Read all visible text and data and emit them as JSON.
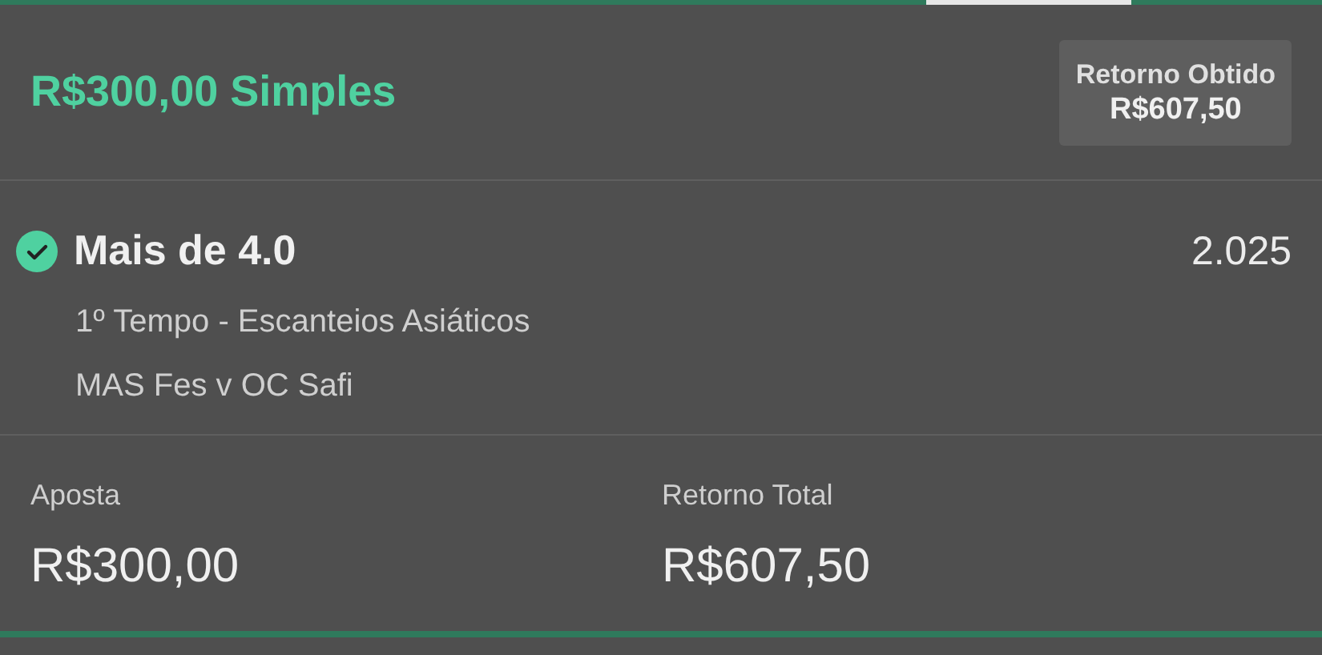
{
  "bet": {
    "title": "R$300,00 Simples",
    "return_badge": {
      "label": "Retorno Obtido",
      "amount": "R$607,50"
    }
  },
  "selection": {
    "won": true,
    "name": "Mais de 4.0",
    "odds": "2.025",
    "market": "1º Tempo - Escanteios Asiáticos",
    "event": "MAS Fes v OC Safi"
  },
  "summary": [
    {
      "label": "Aposta",
      "value": "R$300,00"
    },
    {
      "label": "Retorno Total",
      "value": "R$607,50"
    }
  ]
}
